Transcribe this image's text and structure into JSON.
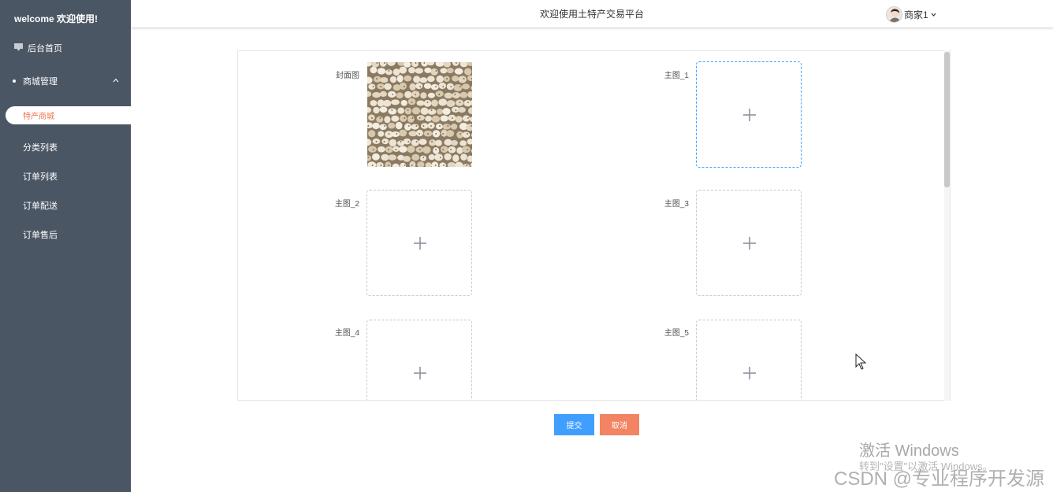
{
  "sidebar": {
    "brand": "welcome 欢迎使用!",
    "items": [
      {
        "label": "后台首页",
        "icon": "monitor-icon"
      },
      {
        "label": "商城管理",
        "icon": "dot-icon"
      },
      {
        "label": "特产商城",
        "active": true
      },
      {
        "label": "分类列表"
      },
      {
        "label": "订单列表"
      },
      {
        "label": "订单配送"
      },
      {
        "label": "订单售后"
      }
    ]
  },
  "header": {
    "title": "欢迎使用土特产交易平台",
    "user": "商家1"
  },
  "form": {
    "fields": [
      {
        "label": "封面图",
        "has_image": true
      },
      {
        "label": "主图_1"
      },
      {
        "label": "主图_2"
      },
      {
        "label": "主图_3"
      },
      {
        "label": "主图_4"
      },
      {
        "label": "主图_5"
      }
    ]
  },
  "actions": {
    "submit": "提交",
    "cancel": "取消"
  },
  "watermarks": {
    "windows_line1": "激活 Windows",
    "windows_line2": "转到\"设置\"以激活 Windows。",
    "csdn": "CSDN @专业程序开发源"
  },
  "colors": {
    "sidebar_bg": "#4b5664",
    "active_text": "#f0734b",
    "primary": "#409eff",
    "cancel": "#f38463"
  }
}
